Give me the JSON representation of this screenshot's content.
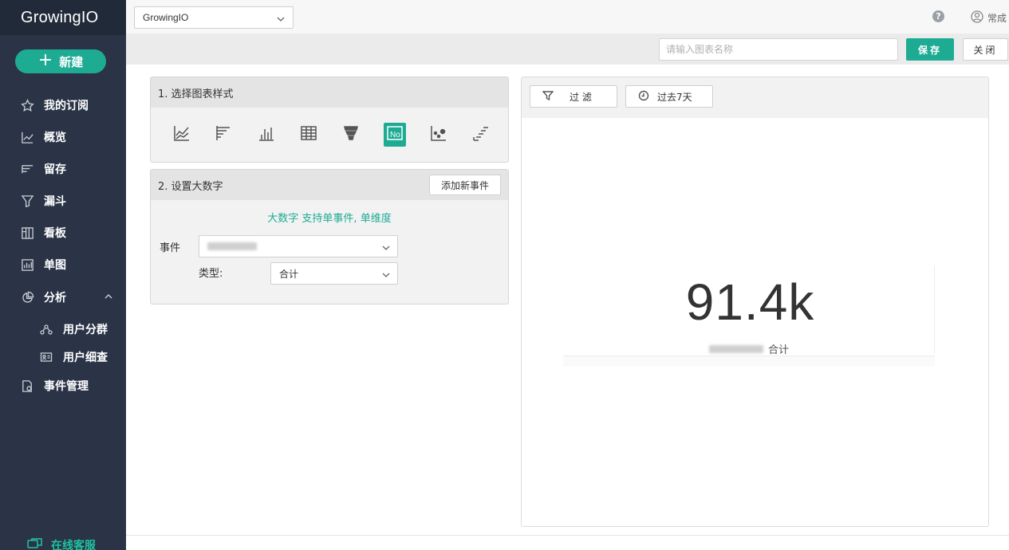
{
  "sidebar": {
    "brand": "GrowingIO",
    "new_button": "新建",
    "items": [
      {
        "label": "我的订阅",
        "icon": "star-icon"
      },
      {
        "label": "概览",
        "icon": "line-chart-icon"
      },
      {
        "label": "留存",
        "icon": "retention-icon"
      },
      {
        "label": "漏斗",
        "icon": "funnel-icon"
      },
      {
        "label": "看板",
        "icon": "dashboard-icon"
      },
      {
        "label": "单图",
        "icon": "bar-chart-icon"
      },
      {
        "label": "分析",
        "icon": "pie-chart-icon",
        "expanded": true
      },
      {
        "label": "事件管理",
        "icon": "event-manage-icon"
      }
    ],
    "sub_items": [
      {
        "label": "用户分群",
        "icon": "user-segment-icon"
      },
      {
        "label": "用户细查",
        "icon": "user-profile-icon"
      }
    ],
    "support": "在线客服"
  },
  "topbar": {
    "project": "GrowingIO",
    "help": "?",
    "user": "常成"
  },
  "actionbar": {
    "name_placeholder": "请输入图表名称",
    "save": "保存",
    "close": "关闭"
  },
  "step1": {
    "title": "1. 选择图表样式",
    "chart_types": [
      "line",
      "bar-horizontal",
      "bar-vertical",
      "table",
      "funnel",
      "big-number",
      "scatter",
      "stacked-horizontal"
    ],
    "selected": "big-number",
    "active_label": "No"
  },
  "step2": {
    "title": "2. 设置大数字",
    "add_event": "添加新事件",
    "tip": "大数字 支持单事件, 单维度",
    "event_label": "事件",
    "type_label": "类型:",
    "type_value": "合计"
  },
  "preview": {
    "filter": "过 滤",
    "date_range": "过去7天",
    "value": "91.4k",
    "caption_suffix": "合计"
  },
  "colors": {
    "accent": "#1eab94",
    "sidebar": "#2a3446",
    "sidebar_brand": "#212a39"
  }
}
